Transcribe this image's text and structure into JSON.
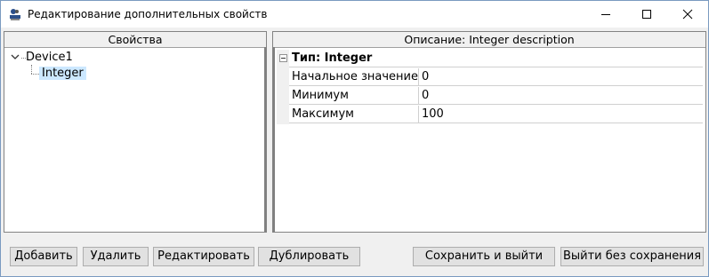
{
  "window": {
    "title": "Редактирование дополнительных свойств",
    "icon": "app-logo-icon"
  },
  "left_panel": {
    "header": "Свойства",
    "tree": [
      {
        "label": "Device1",
        "expanded": true
      },
      {
        "label": "Integer",
        "selected": true
      }
    ]
  },
  "right_panel": {
    "header": "Описание: Integer description",
    "group": {
      "label": "Тип: Integer",
      "expanded": true
    },
    "rows": [
      {
        "name": "Начальное значение",
        "value": "0"
      },
      {
        "name": "Минимум",
        "value": "0"
      },
      {
        "name": "Максимум",
        "value": "100"
      }
    ]
  },
  "buttons": {
    "add": "Добавить",
    "delete": "Удалить",
    "edit": "Редактировать",
    "duplicate": "Дублировать",
    "save_exit": "Сохранить и выйти",
    "exit_no_save": "Выйти без сохранения"
  },
  "colors": {
    "selection": "#cce8ff",
    "window_bg": "#f0f0f0"
  }
}
